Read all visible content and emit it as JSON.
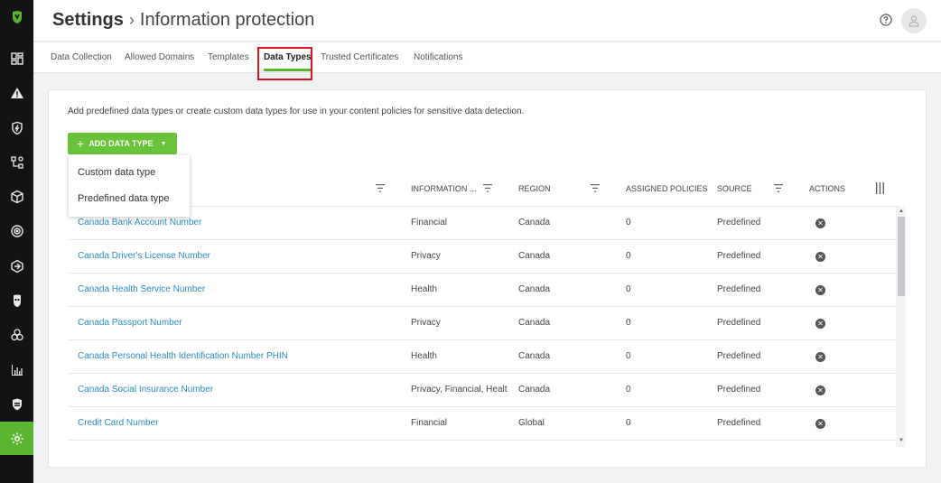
{
  "header": {
    "title": "Settings",
    "separator": "›",
    "subtitle": "Information protection"
  },
  "tabs": [
    {
      "label": "Data Collection"
    },
    {
      "label": "Allowed Domains"
    },
    {
      "label": "Templates"
    },
    {
      "label": "Data Types"
    },
    {
      "label": "Trusted Certificates"
    },
    {
      "label": "Notifications"
    }
  ],
  "content": {
    "description": "Add predefined data types or create custom data types for use in your content policies for sensitive data detection.",
    "add_button": "ADD DATA TYPE"
  },
  "dropdown": {
    "items": [
      {
        "label": "Custom data type"
      },
      {
        "label": "Predefined data type"
      }
    ]
  },
  "table": {
    "columns": [
      "INFORMATION ...",
      "REGION",
      "ASSIGNED POLICIES",
      "SOURCE",
      "ACTIONS"
    ],
    "rows": [
      {
        "name": "Canada Bank Account Number",
        "info": "Financial",
        "region": "Canada",
        "policies": "0",
        "source": "Predefined"
      },
      {
        "name": "Canada Driver's License Number",
        "info": "Privacy",
        "region": "Canada",
        "policies": "0",
        "source": "Predefined"
      },
      {
        "name": "Canada Health Service Number",
        "info": "Health",
        "region": "Canada",
        "policies": "0",
        "source": "Predefined"
      },
      {
        "name": "Canada Passport Number",
        "info": "Privacy",
        "region": "Canada",
        "policies": "0",
        "source": "Predefined"
      },
      {
        "name": "Canada Personal Health Identification Number PHIN",
        "info": "Health",
        "region": "Canada",
        "policies": "0",
        "source": "Predefined"
      },
      {
        "name": "Canada Social Insurance Number",
        "info": "Privacy, Financial, Healt",
        "region": "Canada",
        "policies": "0",
        "source": "Predefined"
      },
      {
        "name": "Credit Card Number",
        "info": "Financial",
        "region": "Global",
        "policies": "0",
        "source": "Predefined"
      }
    ]
  },
  "colors": {
    "accent": "#5cb531",
    "link": "#2d8bc1",
    "highlight": "#e2121f",
    "sidebar": "#111315"
  },
  "icons": [
    "logo-icon",
    "dashboard-icon",
    "alert-icon",
    "shield-bolt-icon",
    "network-icon",
    "cube-icon",
    "target-icon",
    "hexagon-icon",
    "mask-icon",
    "biohazard-icon",
    "chart-icon",
    "shield-icon",
    "gear-icon",
    "help-icon",
    "user-icon",
    "filter-icon",
    "column-chooser-icon",
    "remove-icon"
  ]
}
